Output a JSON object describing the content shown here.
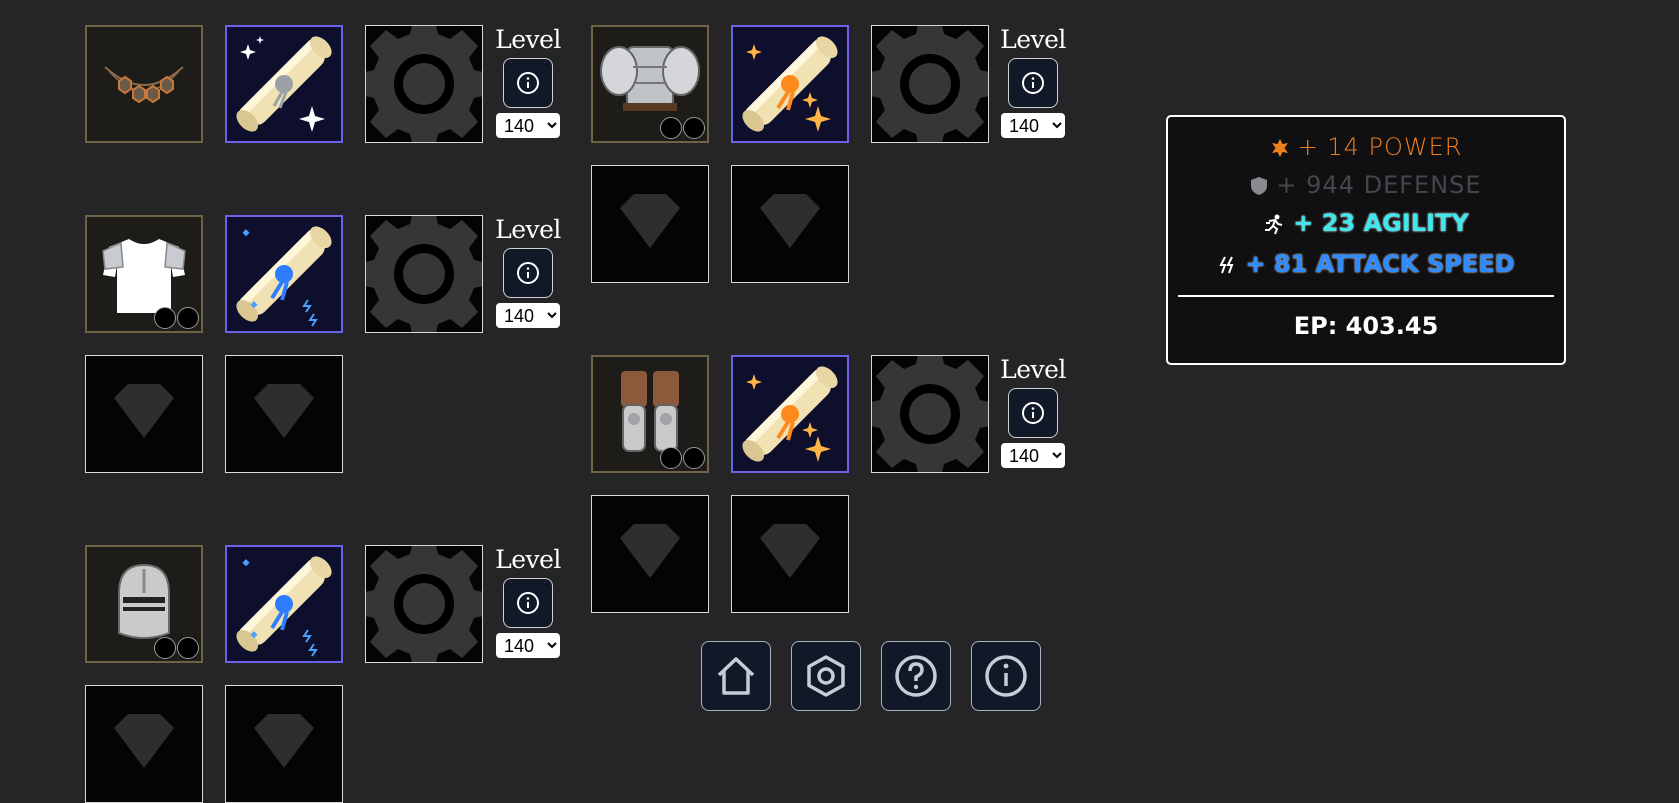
{
  "level_label": "Level",
  "level_options": [
    "140"
  ],
  "level_values": {
    "necklace": "140",
    "chest": "140",
    "helmet": "140",
    "shoulder": "140",
    "pants": "140"
  },
  "stats": {
    "power": "+ 14 POWER",
    "defense": "+ 944 DEFENSE",
    "agility": "+ 23 AGILITY",
    "attack_speed": "+ 81 ATTACK SPEED",
    "ep": "EP: 403.45"
  },
  "icons": {
    "nav": [
      "home-icon",
      "settings-icon",
      "help-icon",
      "info-icon"
    ],
    "scroll_colors": {
      "gray": "#9aa0a6",
      "blue": "#2f7dff",
      "orange": "#ff8a1c"
    }
  },
  "colors": {
    "background": "#252527",
    "power": "#f07f1d",
    "defense": "#46464a",
    "agility": "#3ee8ec",
    "attack_speed": "#2d8bff",
    "scroll_border": "#6b63e6",
    "item_border": "#6e6445"
  }
}
